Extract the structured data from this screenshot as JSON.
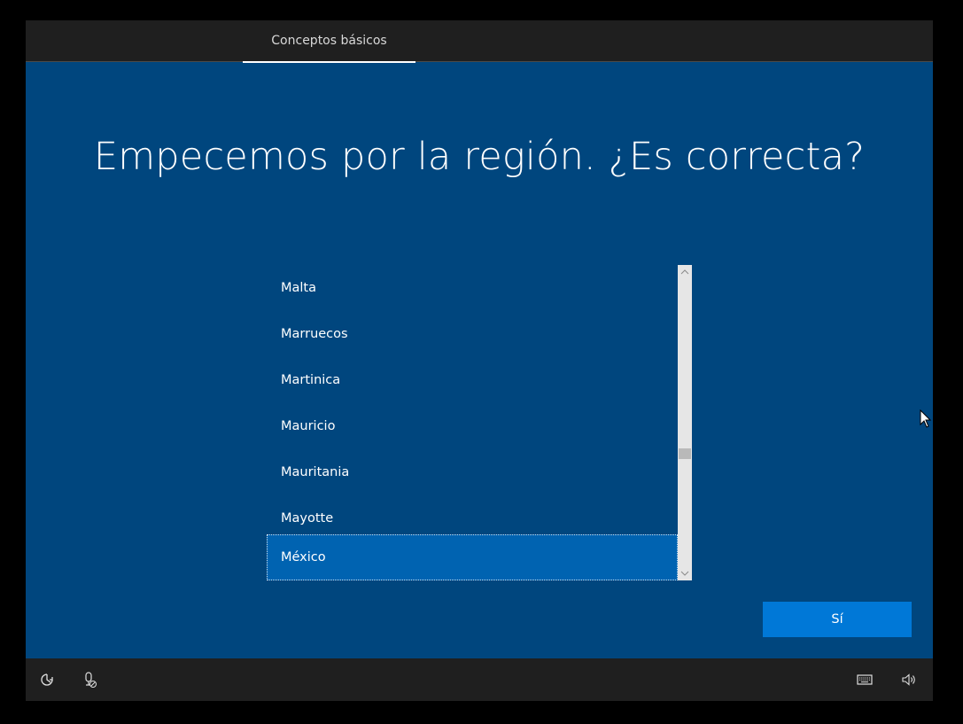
{
  "header": {
    "tab_label": "Conceptos básicos"
  },
  "main": {
    "title": "Empecemos por la región. ¿Es correcta?",
    "region_list": {
      "items": [
        "Malta",
        "Marruecos",
        "Martinica",
        "Mauricio",
        "Mauritania",
        "Mayotte",
        "México"
      ],
      "selected": "México"
    },
    "confirm_label": "Sí"
  },
  "footer": {
    "icons": [
      "ease-of-access-icon",
      "microphone-off-icon",
      "keyboard-icon",
      "volume-icon"
    ]
  },
  "colors": {
    "background": "#00467e",
    "bars": "#1f1f1f",
    "accent": "#0078d7",
    "selected_item": "#0063b1"
  }
}
